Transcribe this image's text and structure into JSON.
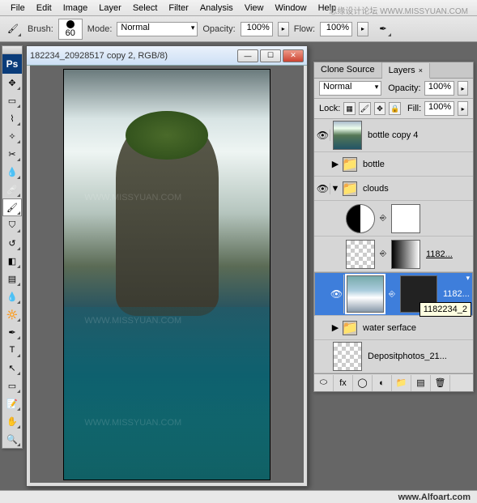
{
  "menu": [
    "File",
    "Edit",
    "Image",
    "Layer",
    "Select",
    "Filter",
    "Analysis",
    "View",
    "Window",
    "Help"
  ],
  "options": {
    "brush_label": "Brush:",
    "brush_size": "60",
    "mode_label": "Mode:",
    "mode_value": "Normal",
    "opacity_label": "Opacity:",
    "opacity_value": "100%",
    "flow_label": "Flow:",
    "flow_value": "100%"
  },
  "doc": {
    "title": "182234_20928517 copy 2, RGB/8)"
  },
  "panel": {
    "tabs": [
      "Clone Source",
      "Layers"
    ],
    "active_tab": 1,
    "blend_mode": "Normal",
    "opacity_label": "Opacity:",
    "opacity_value": "100%",
    "lock_label": "Lock:",
    "fill_label": "Fill:",
    "fill_value": "100%"
  },
  "layers": [
    {
      "name": "bottle copy 4",
      "visible": true,
      "type": "layer",
      "thumb": "island"
    },
    {
      "name": "bottle",
      "visible": false,
      "type": "group",
      "expanded": false
    },
    {
      "name": "clouds",
      "visible": true,
      "type": "group",
      "expanded": true
    },
    {
      "name": "",
      "visible": false,
      "type": "adjustment",
      "nested": true
    },
    {
      "name": "1182...",
      "visible": false,
      "type": "masked",
      "nested": true,
      "thumb": "cb",
      "mask": "grad",
      "underline": true
    },
    {
      "name": "1182...",
      "visible": true,
      "type": "masked",
      "nested": true,
      "thumb": "sky",
      "mask": "dark",
      "selected": true,
      "big": true
    },
    {
      "name": "water serface",
      "visible": false,
      "type": "group",
      "expanded": false
    },
    {
      "name": "Depositphotos_21...",
      "visible": false,
      "type": "layer",
      "thumb": "cb"
    }
  ],
  "tooltip": "1182234_2",
  "footer_link": "www.Alfoart.com",
  "watermark_top": "思缘设计论坛  WWW.MISSYUAN.COM",
  "watermark": "WWW.MISSYUAN.COM"
}
